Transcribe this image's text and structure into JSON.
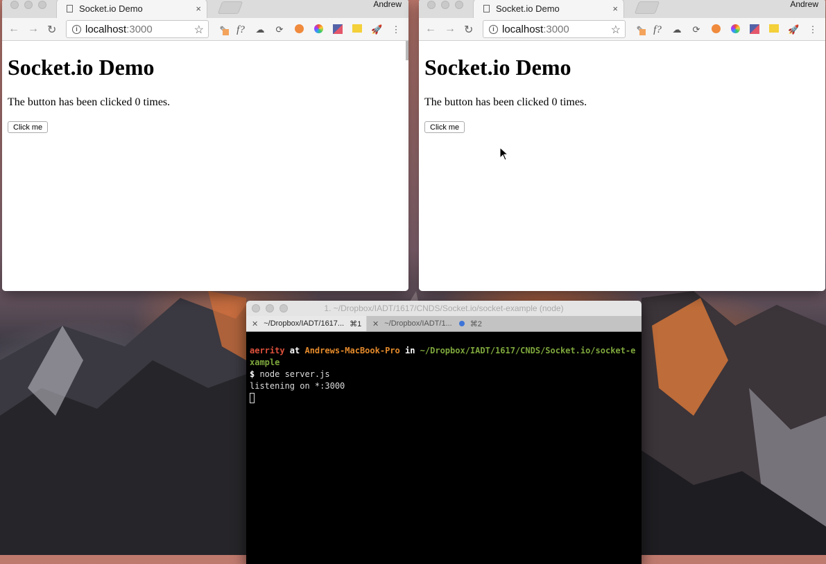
{
  "browsers": [
    {
      "tab_title": "Socket.io Demo",
      "tab_close": "×",
      "profile": "Andrew",
      "url_host": "localhost",
      "url_port": ":3000",
      "heading": "Socket.io Demo",
      "paragraph": "The button has been clicked 0 times.",
      "button_label": "Click me"
    },
    {
      "tab_title": "Socket.io Demo",
      "tab_close": "×",
      "profile": "Andrew",
      "url_host": "localhost",
      "url_port": ":3000",
      "heading": "Socket.io Demo",
      "paragraph": "The button has been clicked 0 times.",
      "button_label": "Click me"
    }
  ],
  "toolbar_icons": [
    "back-icon",
    "forward-icon",
    "reload-icon",
    "info-icon",
    "star-icon",
    "eyedropper-icon",
    "function-icon",
    "cloud-icon",
    "sync-icon",
    "orange-circle-icon",
    "color-wheel-icon",
    "flag-icon",
    "yellow-box-icon",
    "rocket-icon",
    "menu-icon"
  ],
  "terminal": {
    "title": "1. ~/Dropbox/IADT/1617/CNDS/Socket.io/socket-example (node)",
    "tab1_label": "~/Dropbox/IADT/1617...",
    "tab1_shortcut": "⌘1",
    "tab2_label": "~/Dropbox/IADT/1...",
    "tab2_shortcut": "⌘2",
    "prompt_user": "aerrity",
    "prompt_at": " at ",
    "prompt_host": "Andrews-MacBook-Pro",
    "prompt_in": " in ",
    "prompt_path": "~/Dropbox/IADT/1617/CNDS/Socket.io/socket-example",
    "dollar": "$",
    "command": " node server.js",
    "output": "listening on *:3000"
  },
  "colors": {
    "prompt_user": "#e0513c",
    "prompt_host": "#e58a2b",
    "prompt_path": "#7ea73c",
    "tab_dot": "#3c74d8"
  }
}
